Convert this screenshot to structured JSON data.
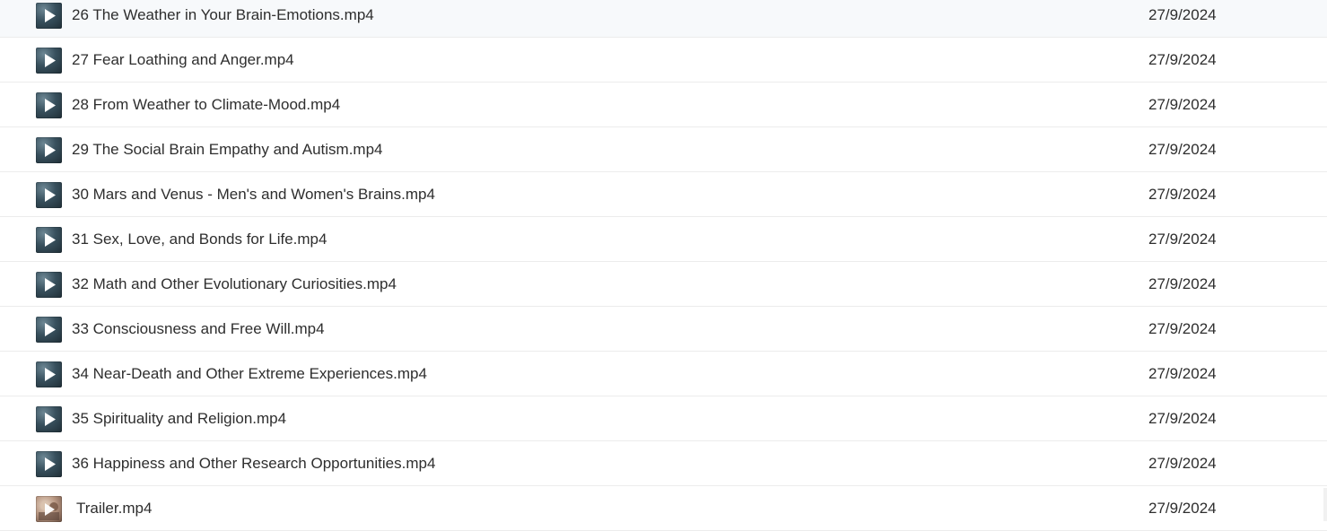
{
  "files": [
    {
      "name": "26 The Weather in Your Brain-Emotions.mp4",
      "date": "27/9/2024",
      "icon": "video-thumbnail-icon"
    },
    {
      "name": "27 Fear Loathing and Anger.mp4",
      "date": "27/9/2024",
      "icon": "video-thumbnail-icon"
    },
    {
      "name": "28 From Weather to Climate-Mood.mp4",
      "date": "27/9/2024",
      "icon": "video-thumbnail-icon"
    },
    {
      "name": "29 The Social Brain Empathy and Autism.mp4",
      "date": "27/9/2024",
      "icon": "video-thumbnail-icon"
    },
    {
      "name": "30 Mars and Venus - Men's and Women's Brains.mp4",
      "date": "27/9/2024",
      "icon": "video-thumbnail-icon"
    },
    {
      "name": "31 Sex, Love, and Bonds for Life.mp4",
      "date": "27/9/2024",
      "icon": "video-thumbnail-icon"
    },
    {
      "name": "32 Math and Other Evolutionary Curiosities.mp4",
      "date": "27/9/2024",
      "icon": "video-thumbnail-icon"
    },
    {
      "name": "33 Consciousness and Free Will.mp4",
      "date": "27/9/2024",
      "icon": "video-thumbnail-icon"
    },
    {
      "name": "34 Near-Death and Other Extreme Experiences.mp4",
      "date": "27/9/2024",
      "icon": "video-thumbnail-icon"
    },
    {
      "name": "35 Spirituality and Religion.mp4",
      "date": "27/9/2024",
      "icon": "video-thumbnail-icon"
    },
    {
      "name": "36 Happiness and Other Research Opportunities.mp4",
      "date": "27/9/2024",
      "icon": "video-thumbnail-icon"
    },
    {
      "name": "Trailer.mp4",
      "date": "27/9/2024",
      "icon": "trailer-thumbnail-icon"
    }
  ],
  "colors": {
    "text": "#2e2e2e",
    "divider": "#ececec",
    "play_glyph": "#ffffff"
  }
}
